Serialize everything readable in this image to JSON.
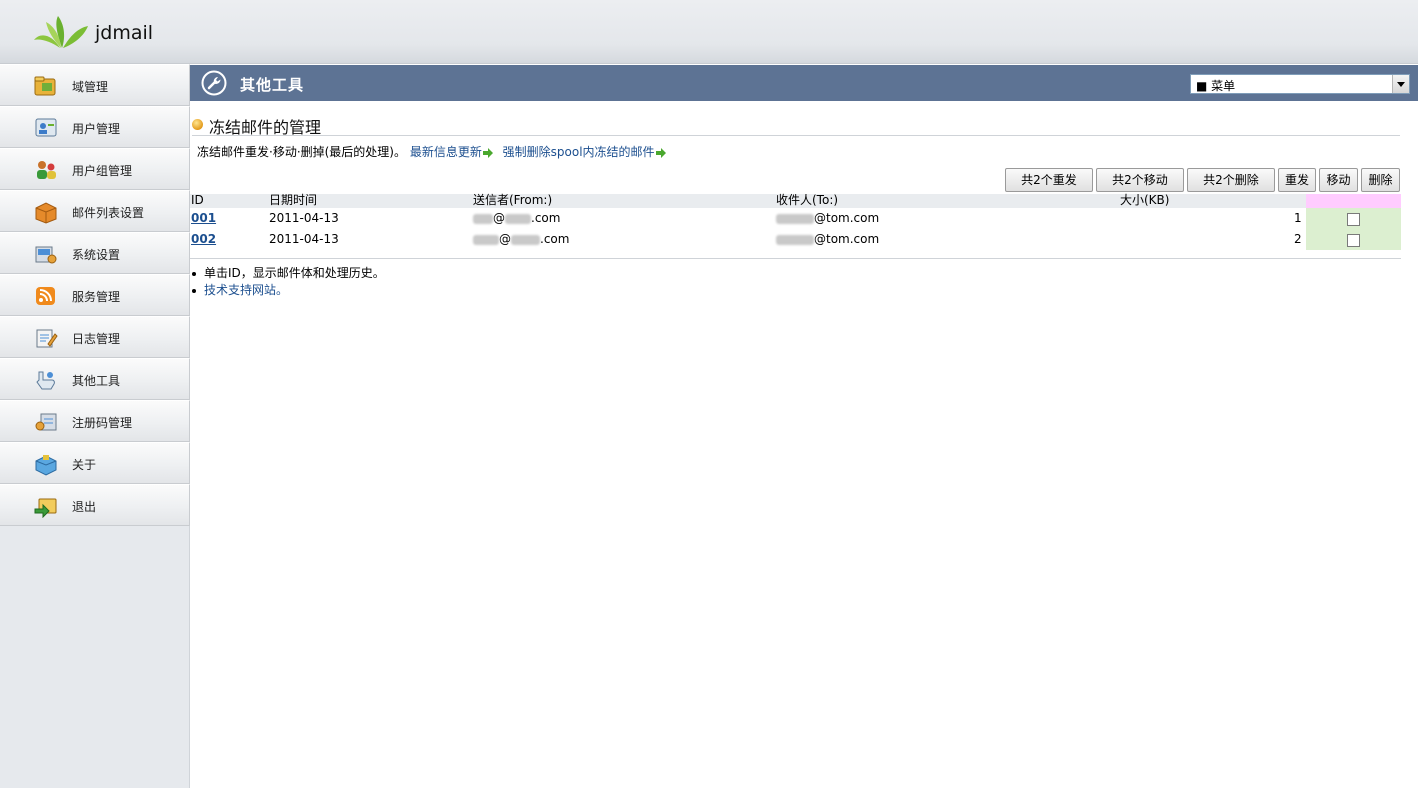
{
  "header": {
    "brand": "jdmail"
  },
  "sidebar": {
    "items": [
      {
        "label": "域管理",
        "icon": "domain-folder-icon"
      },
      {
        "label": "用户管理",
        "icon": "user-card-icon"
      },
      {
        "label": "用户组管理",
        "icon": "user-group-icon"
      },
      {
        "label": "邮件列表设置",
        "icon": "mailing-list-box-icon"
      },
      {
        "label": "系统设置",
        "icon": "system-settings-icon"
      },
      {
        "label": "服务管理",
        "icon": "service-rss-icon"
      },
      {
        "label": "日志管理",
        "icon": "log-notepad-icon"
      },
      {
        "label": "其他工具",
        "icon": "tools-hand-icon"
      },
      {
        "label": "注册码管理",
        "icon": "registration-key-icon"
      },
      {
        "label": "关于",
        "icon": "about-box-icon"
      },
      {
        "label": "退出",
        "icon": "logout-arrow-icon"
      }
    ]
  },
  "main": {
    "title": "其他工具",
    "menu_select": "■ 菜单",
    "section_title": "冻结邮件的管理",
    "ops": {
      "prefix": "冻结邮件重发·移动·删掉(最后的处理)。",
      "link_refresh": "最新信息更新",
      "link_force_delete": "强制删除spool内冻结的邮件"
    },
    "buttons": {
      "resend_all": "共2个重发",
      "move_all": "共2个移动",
      "delete_all": "共2个删除",
      "resend": "重发",
      "move": "移动",
      "delete": "删除"
    },
    "table": {
      "columns": {
        "id": "ID",
        "datetime": "日期时间",
        "from": "送信者(From:)",
        "to": "收件人(To:)",
        "size": "大小(KB)"
      },
      "rows": [
        {
          "id": "001",
          "datetime": "2011-04-13",
          "from_domain_suffix": ".com",
          "to_domain": "@tom.com",
          "size": "1"
        },
        {
          "id": "002",
          "datetime": "2011-04-13",
          "from_domain_suffix": ".com",
          "to_domain": "@tom.com",
          "size": "2"
        }
      ]
    },
    "notes": {
      "hint": "单击ID，显示邮件体和处理历史。",
      "support_link": "技术支持网站。"
    }
  },
  "colors": {
    "titlebar": "#5d7394",
    "link": "#1c4f8f",
    "select_header": "#ffccff",
    "select_cell": "#dcefd0"
  }
}
